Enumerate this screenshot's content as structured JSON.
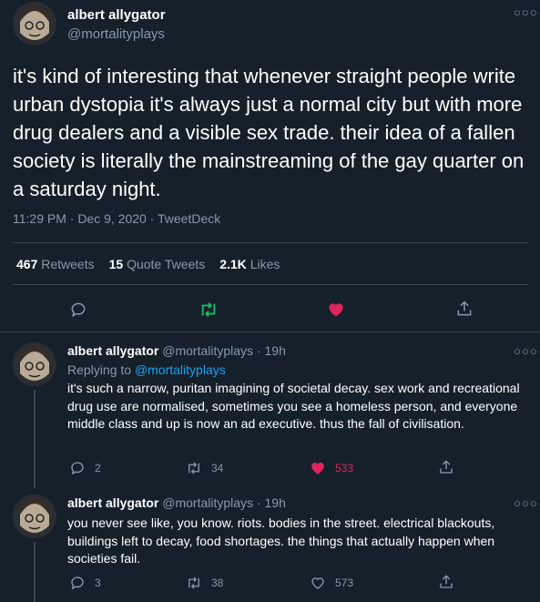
{
  "colors": {
    "background": "#15202b",
    "text": "#ffffff",
    "muted": "#8899a6",
    "link": "#1da1f2",
    "like": "#e0245e",
    "retweet": "#17bf63",
    "divider": "#38444d"
  },
  "main_tweet": {
    "display_name": "albert allygator",
    "handle": "@mortalityplays",
    "more_icon": "more-dots-icon",
    "text": "it's kind of interesting that whenever straight people write urban dystopia it's always just a normal city but with more drug dealers and a visible sex trade. their idea of a fallen society is literally the mainstreaming of the gay quarter on a saturday night.",
    "meta": "11:29 PM · Dec 9, 2020 · TweetDeck",
    "stats": {
      "retweets_count": "467",
      "retweets_label": "Retweets",
      "quote_count": "15",
      "quote_label": "Quote Tweets",
      "likes_count": "2.1K",
      "likes_label": "Likes"
    },
    "actions": [
      "reply-icon",
      "retweet-icon",
      "like-icon-filled",
      "share-icon"
    ]
  },
  "replies": [
    {
      "display_name": "albert allygator",
      "handle": "@mortalityplays",
      "time": "· 19h",
      "replying_prefix": "Replying to",
      "replying_handle": "@mortalityplays",
      "text": "it's such a narrow, puritan imagining of societal decay. sex work and recreational drug use are normalised, sometimes you see a homeless person, and everyone middle class and up is now an ad executive. thus the fall of civilisation.",
      "replies": "2",
      "retweets": "34",
      "likes": "533",
      "liked": true
    },
    {
      "display_name": "albert allygator",
      "handle": "@mortalityplays",
      "time": "· 19h",
      "text": "you never see like, you know. riots. bodies in the street. electrical blackouts, buildings left to decay, food shortages. the things that actually happen when societies fail.",
      "replies": "3",
      "retweets": "38",
      "likes": "573",
      "liked": false
    }
  ]
}
